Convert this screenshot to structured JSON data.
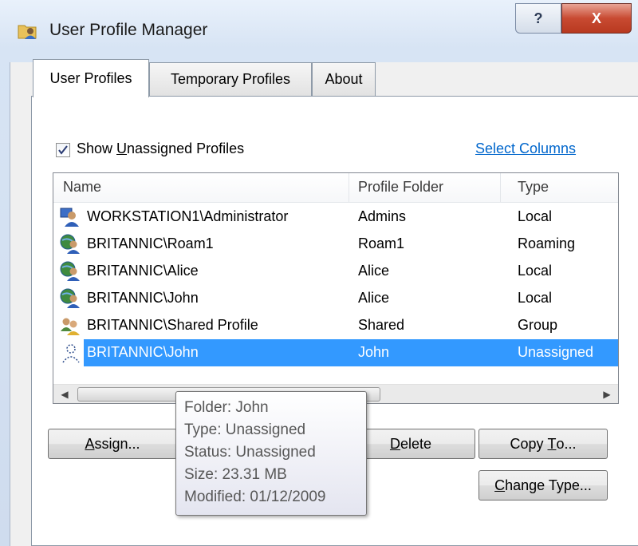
{
  "window": {
    "title": "User Profile Manager",
    "help_glyph": "?",
    "close_glyph": "X"
  },
  "tabs": [
    {
      "label": "User Profiles",
      "active": true
    },
    {
      "label": "Temporary Profiles",
      "active": false
    },
    {
      "label": "About",
      "active": false
    }
  ],
  "options": {
    "show_unassigned_label_pre": "Show ",
    "show_unassigned_label_access": "U",
    "show_unassigned_label_post": "nassigned Profiles",
    "show_unassigned_checked": true,
    "select_columns_link": "Select Columns"
  },
  "table": {
    "columns": [
      "Name",
      "Profile Folder",
      "Type"
    ],
    "rows": [
      {
        "name": "WORKSTATION1\\Administrator",
        "folder": "Admins",
        "type": "Local",
        "icon": "admin-user-icon",
        "selected": false
      },
      {
        "name": "BRITANNIC\\Roam1",
        "folder": "Roam1",
        "type": "Roaming",
        "icon": "domain-user-icon",
        "selected": false
      },
      {
        "name": "BRITANNIC\\Alice",
        "folder": "Alice",
        "type": "Local",
        "icon": "domain-user-icon",
        "selected": false
      },
      {
        "name": "BRITANNIC\\John",
        "folder": "Alice",
        "type": "Local",
        "icon": "domain-user-icon",
        "selected": false
      },
      {
        "name": "BRITANNIC\\Shared Profile",
        "folder": "Shared",
        "type": "Group",
        "icon": "group-user-icon",
        "selected": false
      },
      {
        "name": "BRITANNIC\\John",
        "folder": "John",
        "type": "Unassigned",
        "icon": "unassigned-user-icon",
        "selected": true
      }
    ]
  },
  "buttons": {
    "assign": {
      "access": "A",
      "rest": "ssign..."
    },
    "delete": {
      "access": "D",
      "rest": "elete"
    },
    "copy_to": {
      "pre": "Copy ",
      "access": "T",
      "rest": "o..."
    },
    "change_type": {
      "access": "C",
      "rest": "hange Type..."
    }
  },
  "tooltip": {
    "folder": "Folder: John",
    "type": "Type: Unassigned",
    "status": "Status: Unassigned",
    "size": "Size: 23.31 MB",
    "modified": "Modified: 01/12/2009"
  },
  "colors": {
    "selection": "#3399ff",
    "link": "#0066cc",
    "close_button": "#c84a32"
  }
}
